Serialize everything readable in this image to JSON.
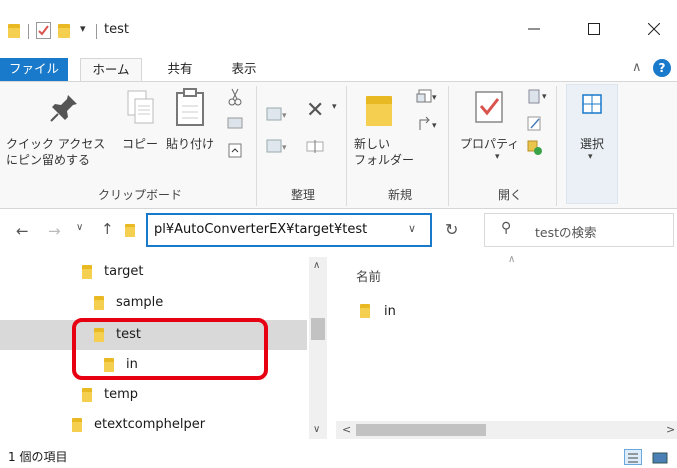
{
  "window": {
    "title": "test",
    "minimize": "—",
    "maximize": "☐",
    "close": "✕"
  },
  "tabs": [
    {
      "label": "ファイル"
    },
    {
      "label": "ホーム"
    },
    {
      "label": "共有"
    },
    {
      "label": "表示"
    }
  ],
  "ribbon": {
    "pin_label": "クイック アクセス\nにピン留めする",
    "copy_label": "コピー",
    "paste_label": "貼り付け",
    "new_folder_label": "新しい\nフォルダー",
    "properties_label": "プロパティ",
    "select_label": "選択",
    "groups": {
      "clipboard": "クリップボード",
      "organize": "整理",
      "new": "新規",
      "open": "開く"
    },
    "help": "?"
  },
  "address": {
    "path": "pl¥AutoConverterEX¥target¥test",
    "search_placeholder": "testの検索"
  },
  "nav": {
    "items": [
      {
        "label": "target"
      },
      {
        "label": "sample"
      },
      {
        "label": "test"
      },
      {
        "label": "in"
      },
      {
        "label": "temp"
      },
      {
        "label": "etextcomphelper"
      }
    ]
  },
  "content": {
    "column_name": "名前",
    "items": [
      {
        "label": "in"
      }
    ]
  },
  "status": {
    "item_count": "1 個の項目"
  },
  "colors": {
    "accent": "#1979ca",
    "highlight_box": "#e60012",
    "folder": "#f5cf4f"
  }
}
